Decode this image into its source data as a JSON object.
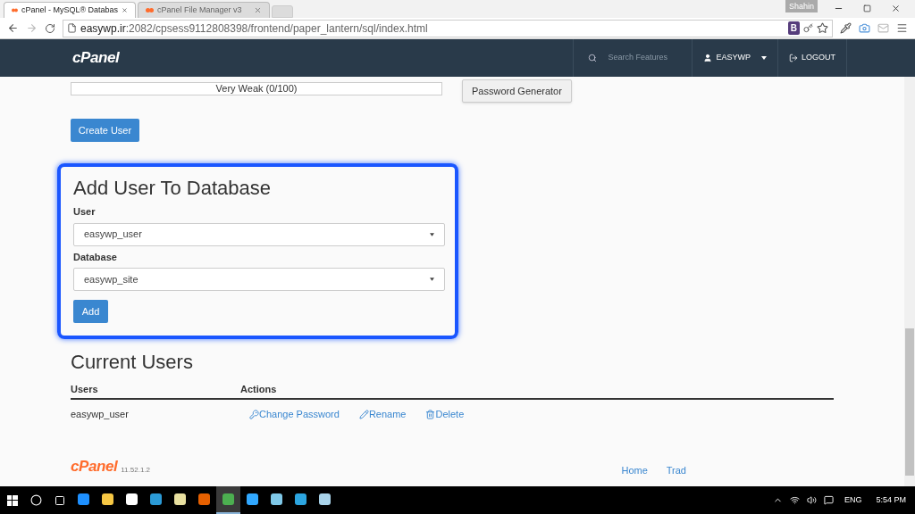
{
  "browser": {
    "tabs": [
      {
        "label": "cPanel - MySQL® Databas",
        "selected": true
      },
      {
        "label": "cPanel File Manager v3",
        "selected": false
      }
    ],
    "profile": "Shahin",
    "address": {
      "host": "easywp.ir",
      "rest": ":2082/cpsess9112808398/frontend/paper_lantern/sql/index.html"
    },
    "extension_badge": "B"
  },
  "header": {
    "logo": "cPanel",
    "search": {
      "placeholder": "Search Features"
    },
    "user": "EASYWP",
    "logout": "LOGOUT"
  },
  "strength": {
    "label": "Very Weak (0/100)"
  },
  "password_generator": "Password Generator",
  "create_user": "Create User",
  "add_user": {
    "title": "Add User To Database",
    "highlighted": true,
    "fields": [
      {
        "label": "User",
        "value": "easywp_user"
      },
      {
        "label": "Database",
        "value": "easywp_site"
      }
    ],
    "button": "Add"
  },
  "current_users": {
    "title": "Current Users",
    "columns": [
      "Users",
      "Actions"
    ],
    "rows": [
      {
        "user": "easywp_user",
        "actions": [
          {
            "kind": "key",
            "label": "Change Password"
          },
          {
            "kind": "pencil",
            "label": "Rename"
          },
          {
            "kind": "trash",
            "label": "Delete"
          }
        ]
      }
    ]
  },
  "footer": {
    "logo": "cPanel",
    "version": "11.52.1.2",
    "links": [
      "Home",
      "Trad"
    ]
  },
  "taskbar": {
    "apps": [
      {
        "kind": "edge",
        "selected": false
      },
      {
        "kind": "folder",
        "selected": false
      },
      {
        "kind": "store",
        "selected": false
      },
      {
        "kind": "app",
        "selected": false
      },
      {
        "kind": "notepad",
        "selected": false
      },
      {
        "kind": "firefox",
        "selected": false
      },
      {
        "kind": "chrome",
        "selected": true
      },
      {
        "kind": "ps",
        "selected": false
      },
      {
        "kind": "image",
        "selected": false
      },
      {
        "kind": "telegram",
        "selected": false
      },
      {
        "kind": "files",
        "selected": false
      }
    ],
    "language": "ENG",
    "time": "5:54 PM"
  }
}
